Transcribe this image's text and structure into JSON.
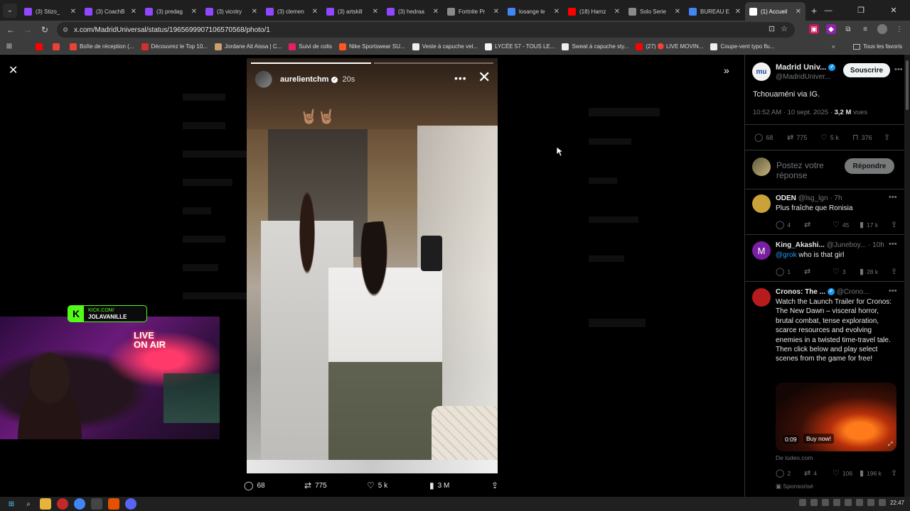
{
  "browser": {
    "tabs": [
      {
        "title": "(3) Stizo_",
        "color": "#9146ff",
        "active": false
      },
      {
        "title": "(3) CoachB",
        "color": "#9146ff",
        "active": false
      },
      {
        "title": "(3) predag",
        "color": "#9146ff",
        "active": false
      },
      {
        "title": "(3) vicotry",
        "color": "#9146ff",
        "active": false
      },
      {
        "title": "(3) clemen",
        "color": "#9146ff",
        "active": false
      },
      {
        "title": "(3) artskill",
        "color": "#9146ff",
        "active": false
      },
      {
        "title": "(3) hedraa",
        "color": "#9146ff",
        "active": false
      },
      {
        "title": "Fortnite Pr",
        "color": "#8a8a8a",
        "active": false
      },
      {
        "title": "losange le",
        "color": "#4285f4",
        "active": false
      },
      {
        "title": "(18) Hamz",
        "color": "#ff0000",
        "active": false
      },
      {
        "title": "Solo Serie",
        "color": "#8a8a8a",
        "active": false
      },
      {
        "title": "BUREAU E",
        "color": "#4285f4",
        "active": false
      },
      {
        "title": "(1) Accueil",
        "color": "#ffffff",
        "active": true
      }
    ],
    "url": "x.com/MadridUniversal/status/1965699907106570568/photo/1",
    "bookmarks": [
      {
        "label": "",
        "color": "#ff0000"
      },
      {
        "label": "",
        "color": "#ea4335"
      },
      {
        "label": "Boîte de réception (...",
        "color": "#ea4335"
      },
      {
        "label": "Découvrez le Top 10...",
        "color": "#d32f2f"
      },
      {
        "label": "Jordane Ait Aissa | C...",
        "color": "#c7a06a"
      },
      {
        "label": "Suivi de colis",
        "color": "#e91e63"
      },
      {
        "label": "Nike Sportswear SU...",
        "color": "#ff5722"
      },
      {
        "label": "Veste à capuche vel...",
        "color": "#eeeeee"
      },
      {
        "label": "LYCÉE 57 - TOUS LE...",
        "color": "#f5f5f5"
      },
      {
        "label": "Sweat à capuche sty...",
        "color": "#eeeeee"
      },
      {
        "label": "(27) 🔴 LIVE MOVIN...",
        "color": "#ff0000"
      },
      {
        "label": "Coupe-vent typo flu...",
        "color": "#eeeeee"
      }
    ],
    "all_bookmarks_label": "Tous les favoris"
  },
  "story": {
    "username": "aurelientchm",
    "time": "20s",
    "emoji": "🤘🏽🤘🏽",
    "progress": [
      1.0,
      0.0
    ]
  },
  "photo_actions": {
    "replies": "68",
    "reposts": "775",
    "likes": "5 k",
    "views": "3 M"
  },
  "post": {
    "name": "Madrid Univ...",
    "handle": "@MadridUniver...",
    "subscribe_label": "Souscrire",
    "text": "Tchouaméni via IG.",
    "meta_time": "10:52 AM · 10 sept. 2025 · ",
    "meta_views": "3,2 M",
    "meta_views_suffix": " vues",
    "stats": {
      "replies": "68",
      "reposts": "775",
      "likes": "5 k",
      "bookmarks": "376"
    },
    "reply_placeholder": "Postez votre réponse",
    "reply_button": "Répondre"
  },
  "replies": [
    {
      "name": "ODEN",
      "handle": "@lsg_lgn · 7h",
      "text": "Plus fraîche que Ronisia",
      "stats": {
        "replies": "4",
        "reposts": "",
        "likes": "45",
        "views": "17 k"
      },
      "avatar_color": "#c9a23a"
    },
    {
      "name": "King_Akashi...",
      "handle": "@Juneboy... · 10h",
      "mention": "@grok",
      "text": " who is that girl",
      "stats": {
        "replies": "1",
        "reposts": "",
        "likes": "3",
        "views": "28 k"
      },
      "avatar_color": "#7b1fa2",
      "avatar_letter": "M"
    },
    {
      "name": "Cronos: The ...",
      "handle": "@Crono...",
      "text": "Watch the Launch Trailer for Cronos: The New Dawn – visceral horror, brutal combat, tense exploration, scarce resources and evolving enemies in a twisted time-travel tale. Then click below and play select scenes from the game for free!",
      "video_duration": "0:09",
      "video_cta": "Buy now!",
      "from": "De ludeo.com",
      "stats": {
        "replies": "2",
        "reposts": "4",
        "likes": "106",
        "views": "196 k"
      },
      "sponsored": "Sponsorisé",
      "avatar_color": "#b71c1c"
    }
  ],
  "stream": {
    "kick_line1": "KICK.COM/",
    "kick_line2": "JOLAVANILLE",
    "neon_line1": "LIVE",
    "neon_line2": "ON AIR"
  },
  "taskbar": {
    "time": "22:47"
  }
}
